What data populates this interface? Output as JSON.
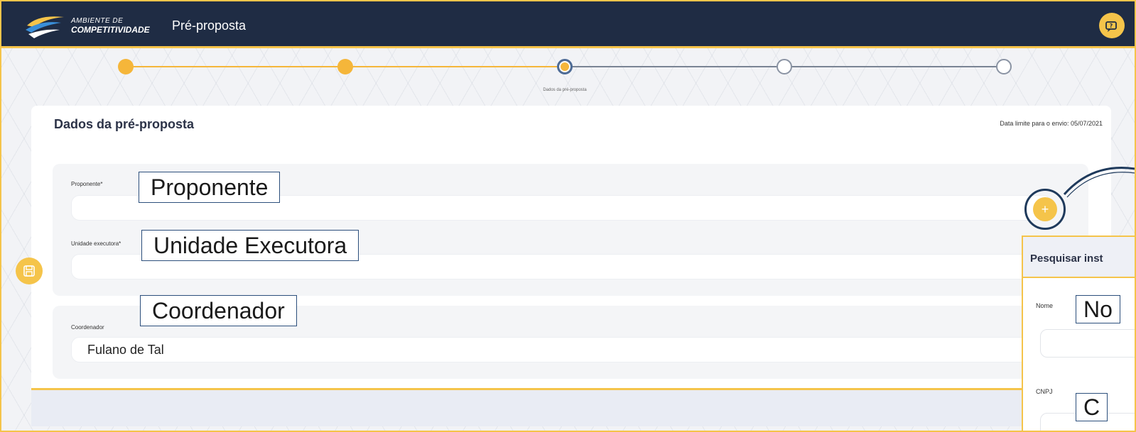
{
  "header": {
    "brand_line1": "AMBIENTE DE",
    "brand_line2": "COMPETITIVIDADE",
    "title": "Pré-proposta"
  },
  "stepper": {
    "current_label": "Dados da pré-proposta",
    "steps": [
      "done",
      "done",
      "current",
      "todo",
      "todo"
    ]
  },
  "page": {
    "title": "Dados da pré-proposta",
    "deadline": "Data limite para o envio: 05/07/2021"
  },
  "form": {
    "proponente_label": "Proponente*",
    "proponente_value": "",
    "unidade_label": "Unidade executora*",
    "unidade_value": "",
    "coordenador_label": "Coordenador",
    "coordenador_value": "Fulano de Tal"
  },
  "callouts": {
    "proponente": "Proponente",
    "unidade": "Unidade Executora",
    "coordenador": "Coordenador",
    "nome": "No",
    "cnpj": "C"
  },
  "search_panel": {
    "title": "Pesquisar inst",
    "nome_label": "Nome",
    "cnpj_label": "CNPJ"
  },
  "colors": {
    "accent": "#f5c44a",
    "navy": "#1f2c44",
    "step_todo": "#8a93a3"
  },
  "icons": {
    "help": "help-chat-icon",
    "save": "save-icon",
    "add": "plus-icon"
  }
}
